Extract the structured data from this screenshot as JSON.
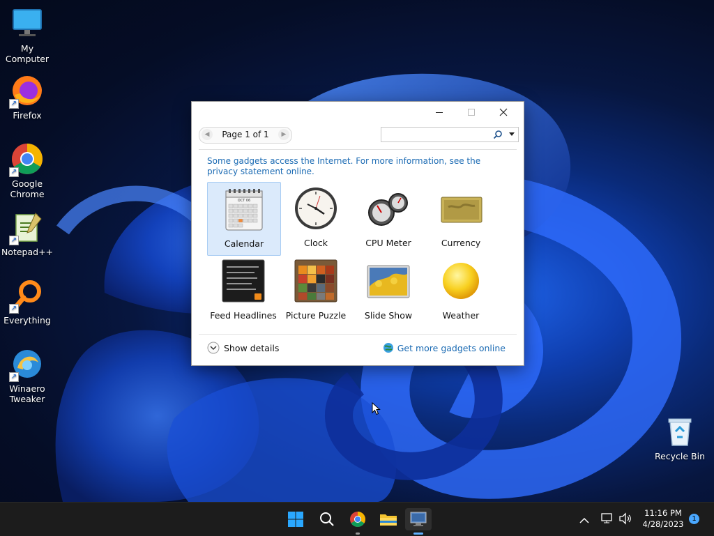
{
  "desktop": {
    "icons": [
      {
        "label": "My Computer"
      },
      {
        "label": "Firefox"
      },
      {
        "label": "Google Chrome"
      },
      {
        "label": "Notepad++"
      },
      {
        "label": "Everything"
      },
      {
        "label": "Winaero Tweaker"
      },
      {
        "label": "Recycle Bin"
      }
    ]
  },
  "window": {
    "pager_text": "Page 1 of 1",
    "search_value": "",
    "info_text": "Some gadgets access the Internet.  For more information, see the privacy statement online.",
    "gadgets": [
      {
        "label": "Calendar",
        "icon": "calendar-icon",
        "selected": true
      },
      {
        "label": "Clock",
        "icon": "clock-icon"
      },
      {
        "label": "CPU Meter",
        "icon": "cpu-meter-icon"
      },
      {
        "label": "Currency",
        "icon": "currency-icon"
      },
      {
        "label": "Feed Headlines",
        "icon": "feed-headlines-icon"
      },
      {
        "label": "Picture Puzzle",
        "icon": "picture-puzzle-icon"
      },
      {
        "label": "Slide Show",
        "icon": "slide-show-icon"
      },
      {
        "label": "Weather",
        "icon": "weather-icon"
      }
    ],
    "show_details": "Show details",
    "get_more": "Get more gadgets online",
    "calendar_month": "OCT 06"
  },
  "taskbar": {
    "time": "11:16 PM",
    "date": "4/28/2023",
    "notification_count": "1"
  },
  "colors": {
    "link": "#1a6ab3",
    "taskbar": "#1c1c1c",
    "selection": "#dbeafb"
  }
}
